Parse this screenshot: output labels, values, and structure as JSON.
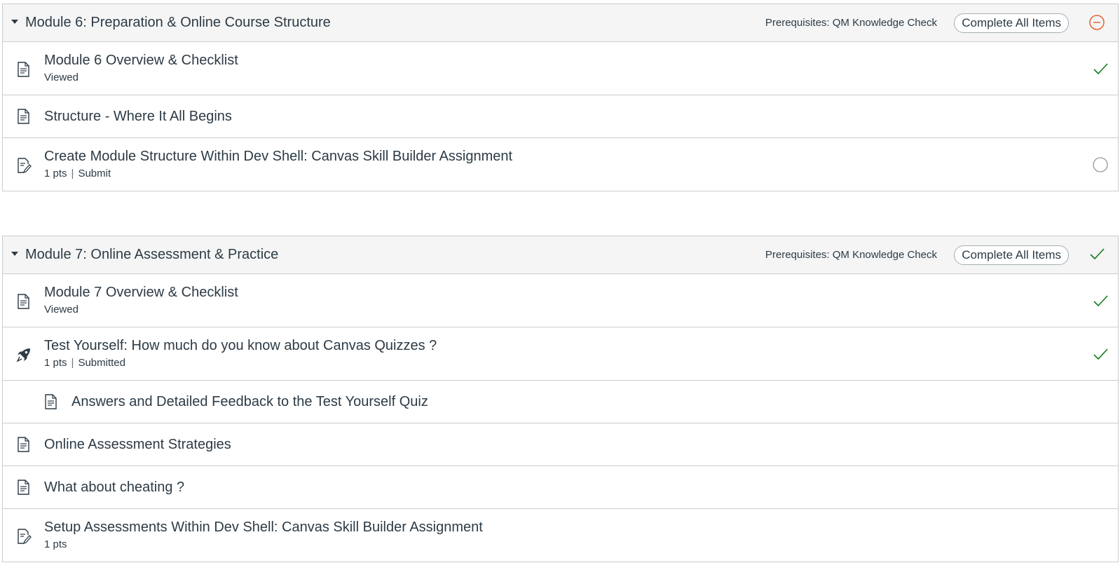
{
  "colors": {
    "accent": "#00AC18",
    "check": "#127A1B",
    "partial": "#E66135",
    "text": "#2D3B45",
    "border": "#C7CDD1"
  },
  "modules": [
    {
      "title": "Module 6: Preparation & Online Course Structure",
      "prerequisites": "Prerequisites: QM Knowledge Check",
      "requirement": "Complete All Items",
      "status_icon": "partial-minus-icon",
      "items": [
        {
          "title": "Module 6 Overview & Checklist",
          "meta1": "Viewed",
          "icon": "page-icon",
          "status": "check-icon"
        },
        {
          "title": "Structure - Where It All Begins",
          "icon": "page-icon"
        },
        {
          "title": "Create Module Structure Within Dev Shell: Canvas Skill Builder Assignment",
          "meta1": "1 pts",
          "meta2": "Submit",
          "icon": "assignment-icon",
          "status": "empty-circle-icon"
        }
      ]
    },
    {
      "title": "Module 7: Online Assessment & Practice",
      "prerequisites": "Prerequisites: QM Knowledge Check",
      "requirement": "Complete All Items",
      "status_icon": "check-icon",
      "items": [
        {
          "title": "Module 7 Overview & Checklist",
          "meta1": "Viewed",
          "icon": "page-icon",
          "status": "check-icon"
        },
        {
          "title": "Test Yourself: How much do you know about Canvas Quizzes ?",
          "meta1": "1 pts",
          "meta2": "Submitted",
          "icon": "quiz-rocket-icon",
          "status": "check-icon"
        },
        {
          "title": "Answers and Detailed Feedback to the Test Yourself Quiz",
          "icon": "page-icon"
        },
        {
          "title": "Online Assessment Strategies",
          "icon": "page-icon"
        },
        {
          "title": "What about cheating ?",
          "icon": "page-icon"
        },
        {
          "title": "Setup Assessments Within Dev Shell: Canvas Skill Builder Assignment",
          "meta1": "1 pts",
          "icon": "assignment-icon"
        }
      ]
    }
  ]
}
